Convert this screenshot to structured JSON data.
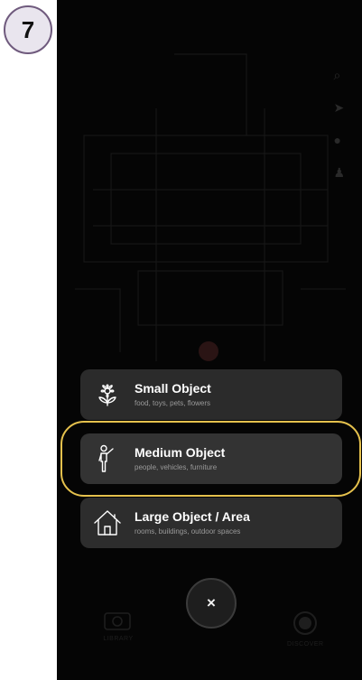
{
  "step_number": "7",
  "object_menu": [
    {
      "title": "Small Object",
      "subtitle": "food, toys, pets, flowers",
      "icon": "flower-icon"
    },
    {
      "title": "Medium Object",
      "subtitle": "people, vehicles, furniture",
      "icon": "person-icon"
    },
    {
      "title": "Large Object / Area",
      "subtitle": "rooms, buildings, outdoor spaces",
      "icon": "house-icon"
    }
  ],
  "close_label": "×",
  "bottom_nav": {
    "left_label": "LIBRARY",
    "right_label": "DISCOVER"
  },
  "highlight_color": "#e5c14d"
}
